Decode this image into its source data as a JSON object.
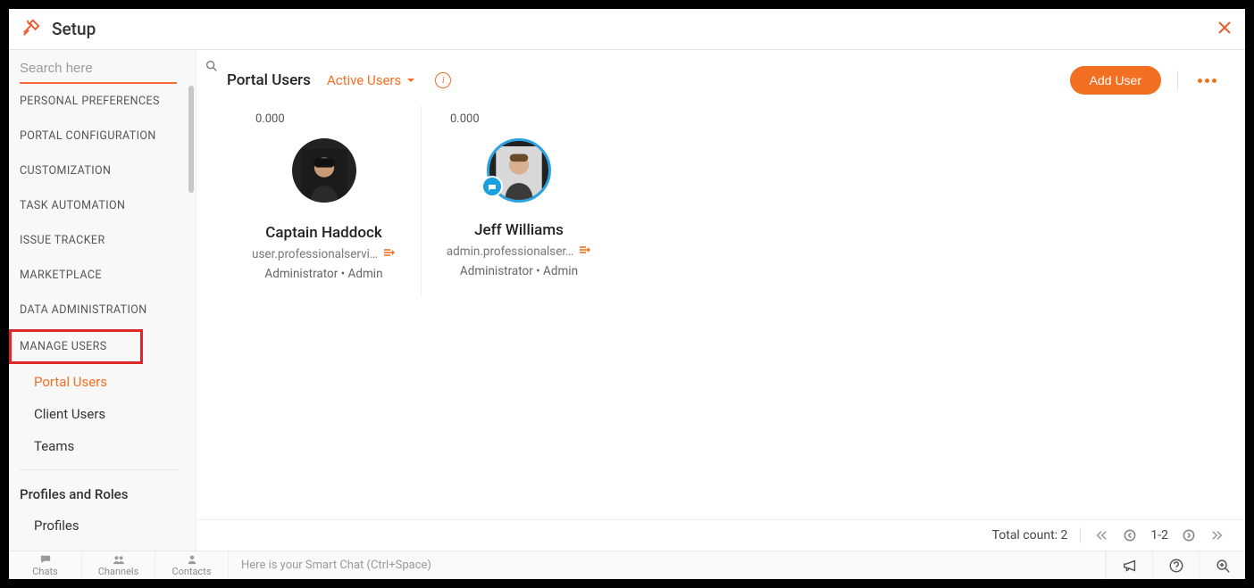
{
  "header": {
    "title": "Setup"
  },
  "sidebar": {
    "search_placeholder": "Search here",
    "groups": [
      "PERSONAL PREFERENCES",
      "PORTAL CONFIGURATION",
      "CUSTOMIZATION",
      "TASK AUTOMATION",
      "ISSUE TRACKER",
      "MARKETPLACE",
      "DATA ADMINISTRATION",
      "MANAGE USERS"
    ],
    "manage_users_children": [
      "Portal Users",
      "Client Users",
      "Teams"
    ],
    "profiles_roles_heading": "Profiles and Roles",
    "profiles_roles_children": [
      "Profiles"
    ]
  },
  "content": {
    "title": "Portal Users",
    "filter_label": "Active Users",
    "add_button": "Add User"
  },
  "users": [
    {
      "zero": "0.000",
      "name": "Captain Haddock",
      "email": "user.professionalservi…",
      "role": "Administrator • Admin",
      "ring": false,
      "badge": false
    },
    {
      "zero": "0.000",
      "name": "Jeff Williams",
      "email": "admin.professionalser…",
      "role": "Administrator • Admin",
      "ring": true,
      "badge": true
    }
  ],
  "pager": {
    "total_label": "Total count: 2",
    "range": "1-2"
  },
  "bottombar": {
    "items": [
      "Chats",
      "Channels",
      "Contacts"
    ],
    "smart_hint": "Here is your Smart Chat (Ctrl+Space)"
  }
}
